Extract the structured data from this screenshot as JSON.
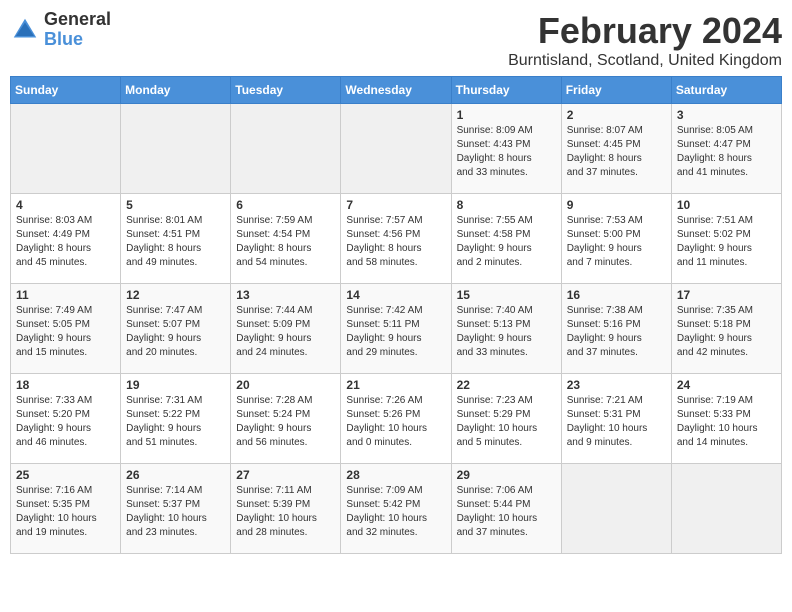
{
  "logo": {
    "general": "General",
    "blue": "Blue"
  },
  "title": "February 2024",
  "subtitle": "Burntisland, Scotland, United Kingdom",
  "days_of_week": [
    "Sunday",
    "Monday",
    "Tuesday",
    "Wednesday",
    "Thursday",
    "Friday",
    "Saturday"
  ],
  "weeks": [
    [
      {
        "day": "",
        "info": ""
      },
      {
        "day": "",
        "info": ""
      },
      {
        "day": "",
        "info": ""
      },
      {
        "day": "",
        "info": ""
      },
      {
        "day": "1",
        "info": "Sunrise: 8:09 AM\nSunset: 4:43 PM\nDaylight: 8 hours\nand 33 minutes."
      },
      {
        "day": "2",
        "info": "Sunrise: 8:07 AM\nSunset: 4:45 PM\nDaylight: 8 hours\nand 37 minutes."
      },
      {
        "day": "3",
        "info": "Sunrise: 8:05 AM\nSunset: 4:47 PM\nDaylight: 8 hours\nand 41 minutes."
      }
    ],
    [
      {
        "day": "4",
        "info": "Sunrise: 8:03 AM\nSunset: 4:49 PM\nDaylight: 8 hours\nand 45 minutes."
      },
      {
        "day": "5",
        "info": "Sunrise: 8:01 AM\nSunset: 4:51 PM\nDaylight: 8 hours\nand 49 minutes."
      },
      {
        "day": "6",
        "info": "Sunrise: 7:59 AM\nSunset: 4:54 PM\nDaylight: 8 hours\nand 54 minutes."
      },
      {
        "day": "7",
        "info": "Sunrise: 7:57 AM\nSunset: 4:56 PM\nDaylight: 8 hours\nand 58 minutes."
      },
      {
        "day": "8",
        "info": "Sunrise: 7:55 AM\nSunset: 4:58 PM\nDaylight: 9 hours\nand 2 minutes."
      },
      {
        "day": "9",
        "info": "Sunrise: 7:53 AM\nSunset: 5:00 PM\nDaylight: 9 hours\nand 7 minutes."
      },
      {
        "day": "10",
        "info": "Sunrise: 7:51 AM\nSunset: 5:02 PM\nDaylight: 9 hours\nand 11 minutes."
      }
    ],
    [
      {
        "day": "11",
        "info": "Sunrise: 7:49 AM\nSunset: 5:05 PM\nDaylight: 9 hours\nand 15 minutes."
      },
      {
        "day": "12",
        "info": "Sunrise: 7:47 AM\nSunset: 5:07 PM\nDaylight: 9 hours\nand 20 minutes."
      },
      {
        "day": "13",
        "info": "Sunrise: 7:44 AM\nSunset: 5:09 PM\nDaylight: 9 hours\nand 24 minutes."
      },
      {
        "day": "14",
        "info": "Sunrise: 7:42 AM\nSunset: 5:11 PM\nDaylight: 9 hours\nand 29 minutes."
      },
      {
        "day": "15",
        "info": "Sunrise: 7:40 AM\nSunset: 5:13 PM\nDaylight: 9 hours\nand 33 minutes."
      },
      {
        "day": "16",
        "info": "Sunrise: 7:38 AM\nSunset: 5:16 PM\nDaylight: 9 hours\nand 37 minutes."
      },
      {
        "day": "17",
        "info": "Sunrise: 7:35 AM\nSunset: 5:18 PM\nDaylight: 9 hours\nand 42 minutes."
      }
    ],
    [
      {
        "day": "18",
        "info": "Sunrise: 7:33 AM\nSunset: 5:20 PM\nDaylight: 9 hours\nand 46 minutes."
      },
      {
        "day": "19",
        "info": "Sunrise: 7:31 AM\nSunset: 5:22 PM\nDaylight: 9 hours\nand 51 minutes."
      },
      {
        "day": "20",
        "info": "Sunrise: 7:28 AM\nSunset: 5:24 PM\nDaylight: 9 hours\nand 56 minutes."
      },
      {
        "day": "21",
        "info": "Sunrise: 7:26 AM\nSunset: 5:26 PM\nDaylight: 10 hours\nand 0 minutes."
      },
      {
        "day": "22",
        "info": "Sunrise: 7:23 AM\nSunset: 5:29 PM\nDaylight: 10 hours\nand 5 minutes."
      },
      {
        "day": "23",
        "info": "Sunrise: 7:21 AM\nSunset: 5:31 PM\nDaylight: 10 hours\nand 9 minutes."
      },
      {
        "day": "24",
        "info": "Sunrise: 7:19 AM\nSunset: 5:33 PM\nDaylight: 10 hours\nand 14 minutes."
      }
    ],
    [
      {
        "day": "25",
        "info": "Sunrise: 7:16 AM\nSunset: 5:35 PM\nDaylight: 10 hours\nand 19 minutes."
      },
      {
        "day": "26",
        "info": "Sunrise: 7:14 AM\nSunset: 5:37 PM\nDaylight: 10 hours\nand 23 minutes."
      },
      {
        "day": "27",
        "info": "Sunrise: 7:11 AM\nSunset: 5:39 PM\nDaylight: 10 hours\nand 28 minutes."
      },
      {
        "day": "28",
        "info": "Sunrise: 7:09 AM\nSunset: 5:42 PM\nDaylight: 10 hours\nand 32 minutes."
      },
      {
        "day": "29",
        "info": "Sunrise: 7:06 AM\nSunset: 5:44 PM\nDaylight: 10 hours\nand 37 minutes."
      },
      {
        "day": "",
        "info": ""
      },
      {
        "day": "",
        "info": ""
      }
    ]
  ]
}
